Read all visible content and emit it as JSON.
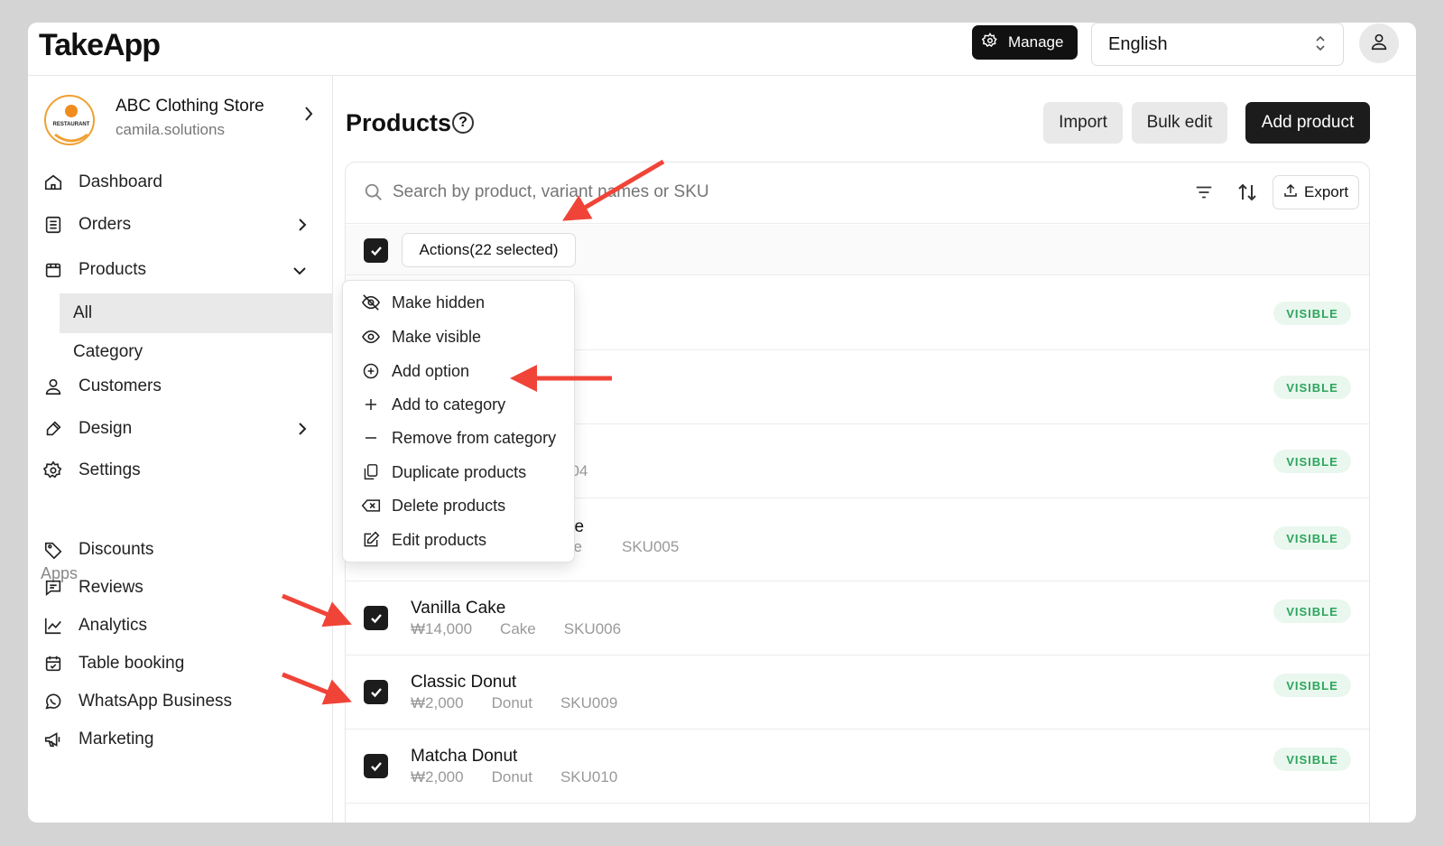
{
  "header": {
    "logo": "TakeApp",
    "manage_label": "Manage",
    "language": "English"
  },
  "sidebar": {
    "store_name": "ABC Clothing Store",
    "store_domain": "camila.solutions",
    "store_logo_text": "RESTAURANT",
    "items": [
      {
        "label": "Dashboard"
      },
      {
        "label": "Orders"
      },
      {
        "label": "Products"
      },
      {
        "label": "Customers"
      },
      {
        "label": "Design"
      },
      {
        "label": "Settings"
      }
    ],
    "product_sub": [
      {
        "label": "All"
      },
      {
        "label": "Category"
      }
    ],
    "apps_label": "Apps",
    "apps": [
      {
        "label": "Discounts"
      },
      {
        "label": "Reviews"
      },
      {
        "label": "Analytics"
      },
      {
        "label": "Table booking"
      },
      {
        "label": "WhatsApp Business"
      },
      {
        "label": "Marketing"
      }
    ]
  },
  "main": {
    "title": "Products",
    "help": "?",
    "import_label": "Import",
    "bulk_edit_label": "Bulk edit",
    "add_product_label": "Add product",
    "search_placeholder": "Search by product, variant names or SKU",
    "export_label": "Export",
    "actions_label": "Actions(22 selected)",
    "rows": [
      {
        "name": "",
        "price": "",
        "category": "",
        "sku": "",
        "status": "VISIBLE"
      },
      {
        "name": "",
        "price": "",
        "category": "",
        "sku": "",
        "status": "VISIBLE"
      },
      {
        "name": "",
        "price": "",
        "category": "",
        "sku": "004",
        "status": "VISIBLE"
      },
      {
        "name": "ke",
        "price": "",
        "category": "ke",
        "sku": "SKU005",
        "status": "VISIBLE"
      },
      {
        "name": "Vanilla Cake",
        "price": "₩14,000",
        "category": "Cake",
        "sku": "SKU006",
        "status": "VISIBLE"
      },
      {
        "name": "Classic Donut",
        "price": "₩2,000",
        "category": "Donut",
        "sku": "SKU009",
        "status": "VISIBLE"
      },
      {
        "name": "Matcha Donut",
        "price": "₩2,000",
        "category": "Donut",
        "sku": "SKU010",
        "status": "VISIBLE"
      }
    ]
  },
  "actions_menu": [
    {
      "label": "Make hidden",
      "icon": "eye-off-icon"
    },
    {
      "label": "Make visible",
      "icon": "eye-icon"
    },
    {
      "label": "Add option",
      "icon": "plus-circle-icon"
    },
    {
      "label": "Add to category",
      "icon": "plus-icon"
    },
    {
      "label": "Remove from category",
      "icon": "minus-icon"
    },
    {
      "label": "Duplicate products",
      "icon": "copy-icon"
    },
    {
      "label": "Delete products",
      "icon": "delete-icon"
    },
    {
      "label": "Edit products",
      "icon": "edit-icon"
    }
  ],
  "colors": {
    "annotation_arrow": "#f04438",
    "visible_badge_text": "#2ca55c",
    "visible_badge_bg": "#e9f7ee"
  }
}
